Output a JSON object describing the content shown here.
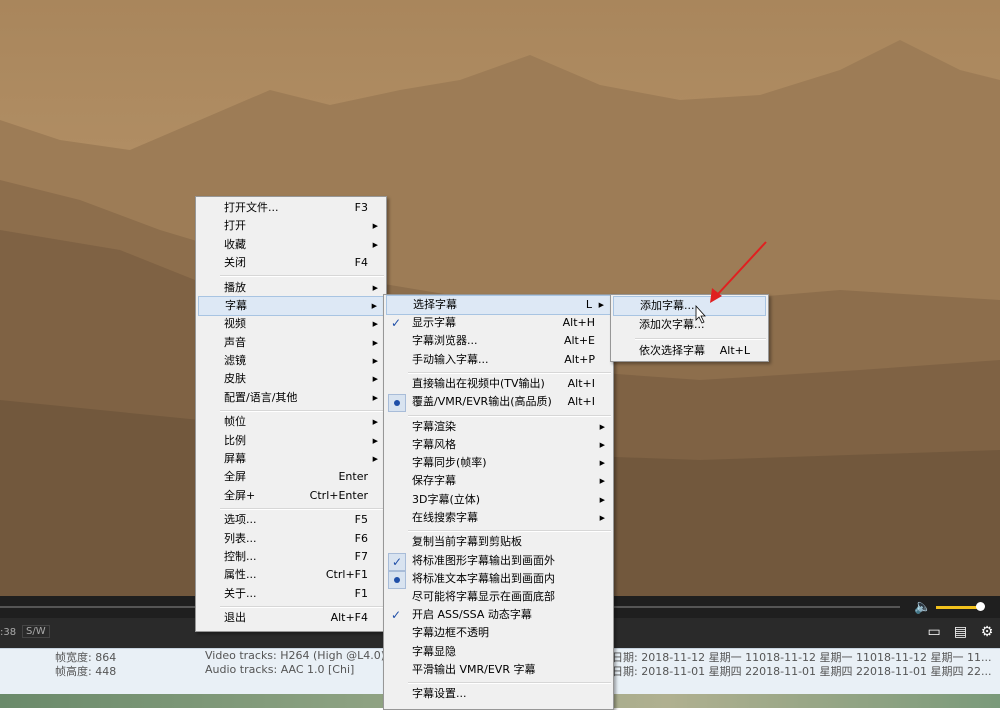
{
  "main_menu": [
    {
      "label": "打开文件...",
      "shortcut": "F3"
    },
    {
      "label": "打开",
      "submenu": true
    },
    {
      "label": "收藏",
      "submenu": true
    },
    {
      "label": "关闭",
      "shortcut": "F4"
    },
    {
      "sep": true
    },
    {
      "label": "播放",
      "submenu": true
    },
    {
      "label": "字幕",
      "submenu": true,
      "highlight": true
    },
    {
      "label": "视频",
      "submenu": true
    },
    {
      "label": "声音",
      "submenu": true
    },
    {
      "label": "滤镜",
      "submenu": true
    },
    {
      "label": "皮肤",
      "submenu": true
    },
    {
      "label": "配置/语言/其他",
      "submenu": true
    },
    {
      "sep": true
    },
    {
      "label": "帧位",
      "submenu": true
    },
    {
      "label": "比例",
      "submenu": true
    },
    {
      "label": "屏幕",
      "submenu": true
    },
    {
      "label": "全屏",
      "shortcut": "Enter"
    },
    {
      "label": "全屏+",
      "shortcut": "Ctrl+Enter"
    },
    {
      "sep": true
    },
    {
      "label": "选项...",
      "shortcut": "F5"
    },
    {
      "label": "列表...",
      "shortcut": "F6"
    },
    {
      "label": "控制...",
      "shortcut": "F7"
    },
    {
      "label": "属性...",
      "shortcut": "Ctrl+F1"
    },
    {
      "label": "关于...",
      "shortcut": "F1"
    },
    {
      "sep": true
    },
    {
      "label": "退出",
      "shortcut": "Alt+F4"
    }
  ],
  "subtitle_menu": [
    {
      "label": "选择字幕",
      "shortcut": "L",
      "submenu": true,
      "highlight": true
    },
    {
      "label": "显示字幕",
      "shortcut": "Alt+H",
      "mark": "check"
    },
    {
      "label": "字幕浏览器...",
      "shortcut": "Alt+E"
    },
    {
      "label": "手动输入字幕...",
      "shortcut": "Alt+P"
    },
    {
      "sep": true
    },
    {
      "label": "直接输出在视频中(TV输出)",
      "shortcut": "Alt+I"
    },
    {
      "label": "覆盖/VMR/EVR输出(高品质)",
      "shortcut": "Alt+I",
      "mark": "dot"
    },
    {
      "sep": true
    },
    {
      "label": "字幕渲染",
      "submenu": true
    },
    {
      "label": "字幕风格",
      "submenu": true
    },
    {
      "label": "字幕同步(帧率)",
      "submenu": true
    },
    {
      "label": "保存字幕",
      "submenu": true
    },
    {
      "label": "3D字幕(立体)",
      "submenu": true
    },
    {
      "label": "在线搜索字幕",
      "submenu": true
    },
    {
      "sep": true
    },
    {
      "label": "复制当前字幕到剪贴板"
    },
    {
      "label": "将标准图形字幕输出到画面外",
      "mark": "check-bg"
    },
    {
      "label": "将标准文本字幕输出到画面内",
      "mark": "dot"
    },
    {
      "label": "尽可能将字幕显示在画面底部"
    },
    {
      "label": "开启 ASS/SSA 动态字幕",
      "mark": "check"
    },
    {
      "label": "字幕边框不透明"
    },
    {
      "label": "字幕显隐"
    },
    {
      "label": "平滑输出 VMR/EVR 字幕"
    },
    {
      "sep": true
    },
    {
      "label": "字幕设置..."
    }
  ],
  "select_menu": [
    {
      "label": "添加字幕...",
      "highlight": true
    },
    {
      "label": "添加次字幕..."
    },
    {
      "sep": true
    },
    {
      "label": "依次选择字幕",
      "shortcut": "Alt+L"
    }
  ],
  "controls": {
    "time": ":38",
    "sw": "S/W"
  },
  "info": {
    "width_label": "帧宽度: 864",
    "height_label": "帧高度: 448",
    "video_tracks": "Video tracks: H264 (High @L4.0)",
    "audio_tracks": "Audio tracks: AAC 1.0 [Chi]",
    "date1": "日期: 2018-11-12 星期一 11018-11-12 星期一 11018-11-12 星期一 11...",
    "date2": "日期: 2018-11-01 星期四 22018-11-01 星期四 22018-11-01 星期四 22..."
  },
  "icons": {
    "volume": "speaker-icon",
    "playlist": "playlist-icon",
    "settings": "gear-icon"
  }
}
